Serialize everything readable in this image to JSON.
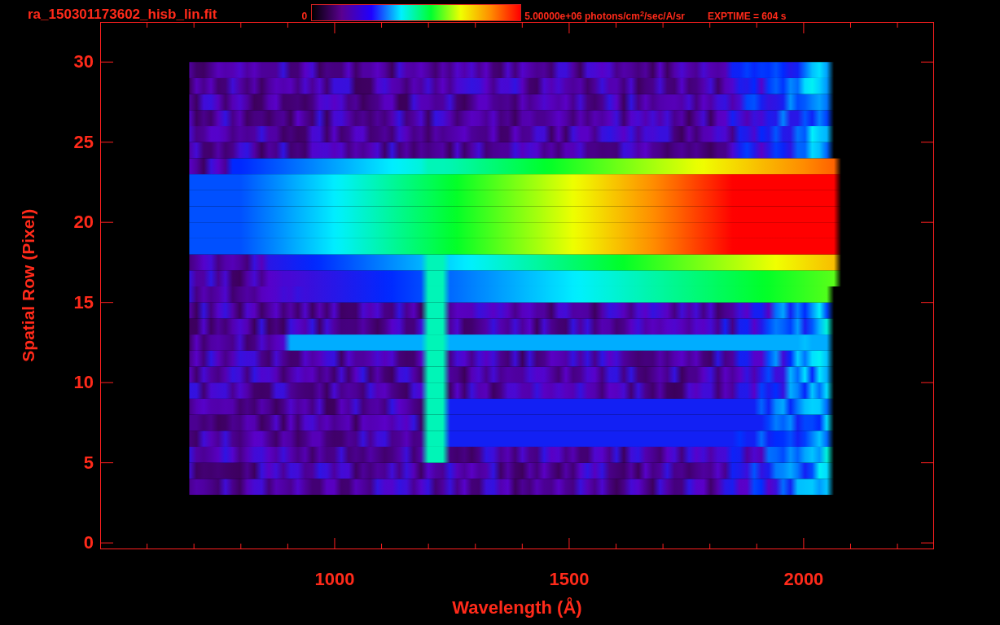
{
  "header": {
    "filename": "ra_150301173602_hisb_lin.fit",
    "colorbar_min": "0",
    "colorbar_max": "5.00000e+06 photons/cm$^{2}$/sec/A/sr",
    "exposure": "EXPTIME = 604 s"
  },
  "plot": {
    "xlabel": "Wavelength (Å)",
    "ylabel": "Spatial Row (Pixel)",
    "xticks": [
      {
        "label": "1000"
      },
      {
        "label": "1500"
      },
      {
        "label": "2000"
      }
    ],
    "yticks": [
      {
        "label": "30"
      },
      {
        "label": "25"
      },
      {
        "label": "20"
      },
      {
        "label": "15"
      },
      {
        "label": "10"
      },
      {
        "label": "5"
      },
      {
        "label": "0"
      }
    ]
  }
}
